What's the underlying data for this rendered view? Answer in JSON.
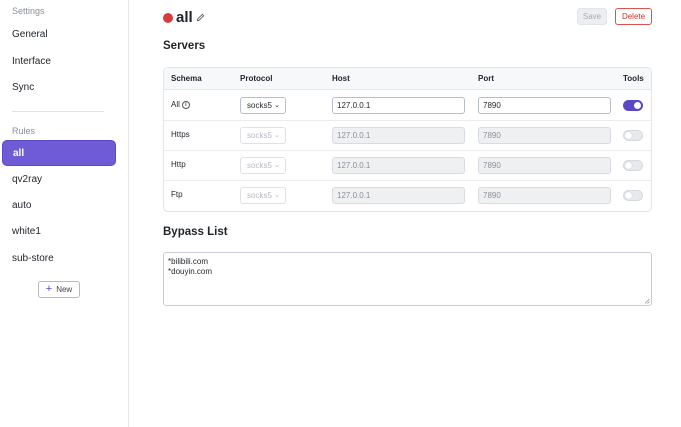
{
  "sidebar": {
    "settings_label": "Settings",
    "settings_items": [
      "General",
      "Interface",
      "Sync"
    ],
    "rules_label": "Rules",
    "rules": [
      "all",
      "qv2ray",
      "auto",
      "white1",
      "sub-store"
    ],
    "active_rule": "all",
    "new_label": "New"
  },
  "header": {
    "title": "all",
    "status_color": "#d63c3c",
    "save_label": "Save",
    "delete_label": "Delete"
  },
  "servers": {
    "heading": "Servers",
    "columns": [
      "Schema",
      "Protocol",
      "Host",
      "Port",
      "Tools"
    ],
    "rows": [
      {
        "schema": "All",
        "protocol": "socks5",
        "host": "127.0.0.1",
        "port": "7890",
        "enabled": true
      },
      {
        "schema": "Https",
        "protocol": "socks5",
        "host": "127.0.0.1",
        "port": "7890",
        "enabled": false
      },
      {
        "schema": "Http",
        "protocol": "socks5",
        "host": "127.0.0.1",
        "port": "7890",
        "enabled": false
      },
      {
        "schema": "Ftp",
        "protocol": "socks5",
        "host": "127.0.0.1",
        "port": "7890",
        "enabled": false
      }
    ]
  },
  "bypass": {
    "heading": "Bypass List",
    "lines": [
      "*bilibili.com",
      "*douyin.com"
    ]
  },
  "colors": {
    "accent": "#6f5bd6",
    "danger": "#d0302a"
  }
}
